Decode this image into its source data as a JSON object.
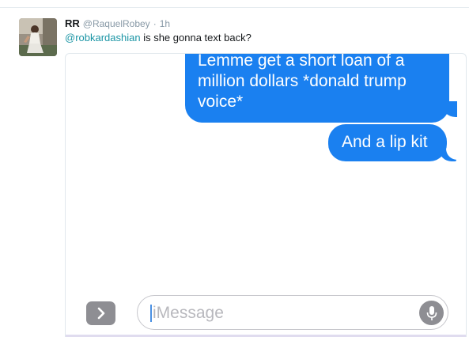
{
  "tweet": {
    "author": {
      "display_name": "RR",
      "handle": "@RaquelRobey"
    },
    "separator": "·",
    "timestamp": "1h",
    "mention": "@robkardashian",
    "text": " is she gonna text back?"
  },
  "imessage": {
    "messages": [
      {
        "text": "Lemme get a short loan of a million dollars *donald trump voice*",
        "sender": "me"
      },
      {
        "text": "And a lip kit",
        "sender": "me"
      }
    ],
    "input_placeholder": "iMessage",
    "bubble_color": "#1a80f0",
    "expand_icon": "chevron-right-icon",
    "mic_icon": "microphone-icon"
  }
}
